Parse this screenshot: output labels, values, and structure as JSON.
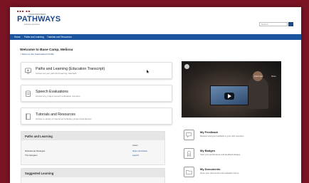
{
  "app": {
    "logo_top": "TOASTMASTERS",
    "logo_main": "PATHWAYS",
    "logo_tagline": "learning experience"
  },
  "header": {
    "search_placeholder": "Search"
  },
  "nav": {
    "items": [
      {
        "label": "Home"
      },
      {
        "label": "Paths and Learning"
      },
      {
        "label": "Tutorials and Resources"
      }
    ]
  },
  "welcome": {
    "title": "Welcome to Base Camp, Melissa",
    "return_link": "< Return to the Toastmasters Profile"
  },
  "cards": [
    {
      "title": "Paths and Learning (Education Transcript)",
      "description": "Access all your path and learning materials",
      "icon": "monitor-play-icon"
    },
    {
      "title": "Speech Evaluations",
      "description": "Access any project speech evaluation resource",
      "icon": "clipboard-icon"
    },
    {
      "title": "Tutorials and Resources",
      "description": "Access a variety of resources including project descriptions",
      "icon": "book-icon"
    }
  ],
  "video": {
    "labels": [
      "Watch later",
      "Share"
    ]
  },
  "paths_panel": {
    "title": "Paths and Learning",
    "column_header": "Action",
    "rows": [
      {
        "name": "Motivational Strategies",
        "action": "Open Curriculum"
      },
      {
        "name": "The Navigator",
        "action": "Launch"
      }
    ]
  },
  "suggested_panel": {
    "title": "Suggested Learning"
  },
  "right_links": [
    {
      "title": "My Feedback",
      "description": "Request and give feedback to your club members",
      "icon": "chat-bubble-icon"
    },
    {
      "title": "My Badges",
      "description": "View your performance and feedback badges",
      "icon": "badge-icon"
    },
    {
      "title": "My Documents",
      "description": "Open your documents and evaluation forms",
      "icon": "folder-icon"
    }
  ],
  "colors": {
    "background": "#7a1424",
    "nav": "#1b55a0",
    "brand": "#1a4a8a"
  }
}
